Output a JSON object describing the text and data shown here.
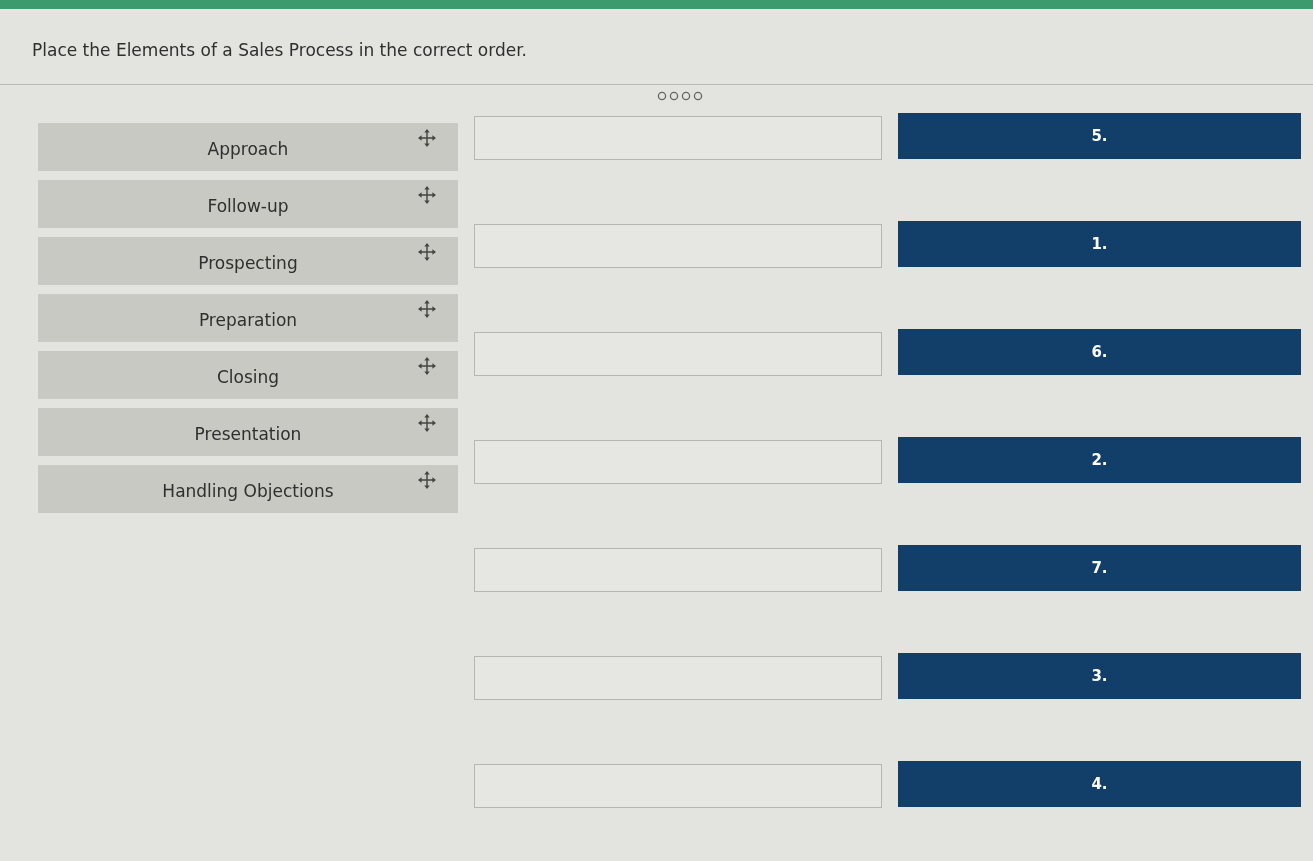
{
  "prompt": "Place the Elements of a Sales Process in the correct order.",
  "items": [
    {
      "label": "Approach"
    },
    {
      "label": "Follow-up"
    },
    {
      "label": "Prospecting"
    },
    {
      "label": "Preparation"
    },
    {
      "label": "Closing"
    },
    {
      "label": "Presentation"
    },
    {
      "label": "Handling Objections"
    }
  ],
  "slots": [
    {
      "number": "5."
    },
    {
      "number": "1."
    },
    {
      "number": "6."
    },
    {
      "number": "2."
    },
    {
      "number": "7."
    },
    {
      "number": "3."
    },
    {
      "number": "4."
    }
  ]
}
